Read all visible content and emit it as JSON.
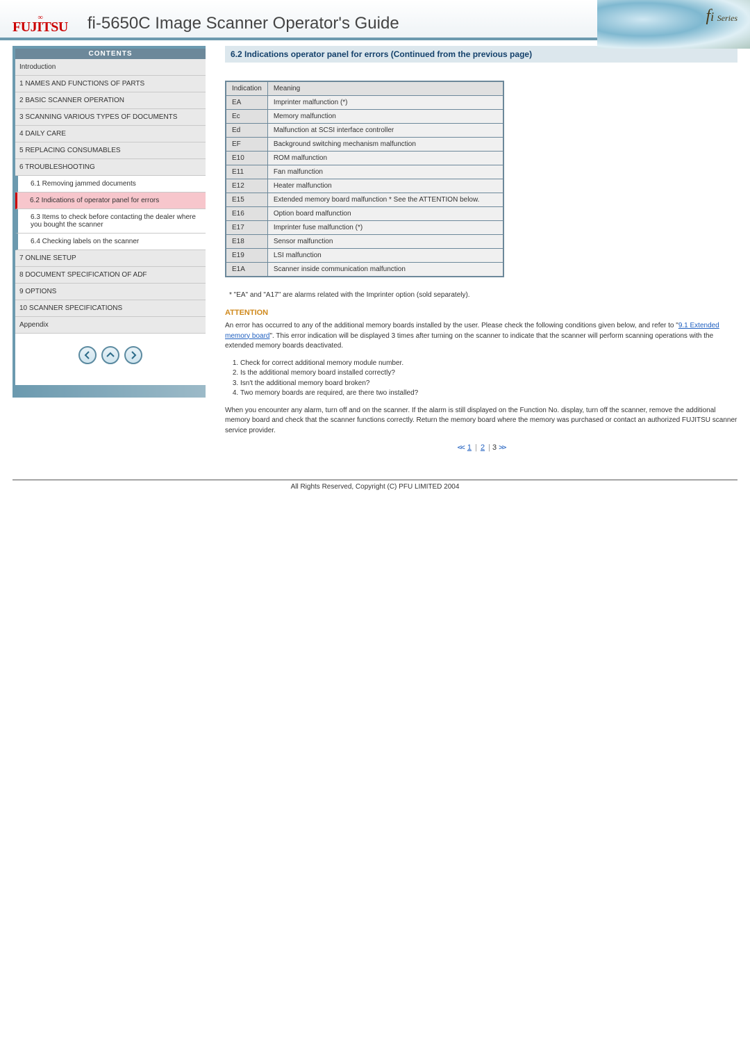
{
  "header": {
    "logo_text": "FUJITSU",
    "title": "fi-5650C Image Scanner Operator's Guide",
    "series_label": "fi Series"
  },
  "sidebar": {
    "contents_label": "CONTENTS",
    "items": [
      {
        "label": "Introduction",
        "type": "item"
      },
      {
        "label": "1 NAMES AND FUNCTIONS OF PARTS",
        "type": "item"
      },
      {
        "label": "2 BASIC SCANNER OPERATION",
        "type": "item"
      },
      {
        "label": "3 SCANNING VARIOUS TYPES OF DOCUMENTS",
        "type": "item"
      },
      {
        "label": "4 DAILY CARE",
        "type": "item"
      },
      {
        "label": "5 REPLACING CONSUMABLES",
        "type": "item"
      },
      {
        "label": "6 TROUBLESHOOTING",
        "type": "item"
      },
      {
        "label": "6.1 Removing jammed documents",
        "type": "sub"
      },
      {
        "label": "6.2 Indications of operator panel for errors",
        "type": "sub",
        "current": true
      },
      {
        "label": "6.3 Items to check before contacting the dealer where you bought the scanner",
        "type": "sub"
      },
      {
        "label": "6.4 Checking labels on the scanner",
        "type": "sub"
      },
      {
        "label": "7 ONLINE SETUP",
        "type": "item"
      },
      {
        "label": "8 DOCUMENT SPECIFICATION OF ADF",
        "type": "item"
      },
      {
        "label": "9 OPTIONS",
        "type": "item"
      },
      {
        "label": "10 SCANNER SPECIFICATIONS",
        "type": "item"
      },
      {
        "label": "Appendix",
        "type": "item"
      }
    ]
  },
  "main": {
    "section_title": "6.2 Indications operator panel for errors (Continued from the previous page)",
    "table": {
      "header": {
        "col1": "Indication",
        "col2": "Meaning"
      },
      "rows": [
        {
          "code": "EA",
          "meaning": "Imprinter malfunction (*)"
        },
        {
          "code": "Ec",
          "meaning": "Memory malfunction"
        },
        {
          "code": "Ed",
          "meaning": "Malfunction at SCSI interface controller"
        },
        {
          "code": "EF",
          "meaning": "Background switching mechanism malfunction"
        },
        {
          "code": "E10",
          "meaning": "ROM malfunction"
        },
        {
          "code": "E11",
          "meaning": "Fan malfunction"
        },
        {
          "code": "E12",
          "meaning": "Heater malfunction"
        },
        {
          "code": "E15",
          "meaning": "Extended memory board malfunction * See the ATTENTION below."
        },
        {
          "code": "E16",
          "meaning": "Option board malfunction"
        },
        {
          "code": "E17",
          "meaning": "Imprinter fuse malfunction (*)"
        },
        {
          "code": "E18",
          "meaning": "Sensor malfunction"
        },
        {
          "code": "E19",
          "meaning": "LSI malfunction"
        },
        {
          "code": "E1A",
          "meaning": "Scanner inside communication malfunction"
        }
      ]
    },
    "footnote": "* \"EA\" and \"A17\" are alarms related with the Imprinter option (sold separately).",
    "attention_label": "ATTENTION",
    "attention_para_pre": "An error has occurred to any of the additional memory boards installed by the user. Please check the following conditions given below, and refer to \"",
    "attention_link": "9.1 Extended memory board",
    "attention_para_post": "\". This error indication will be displayed 3 times after turning on the scanner to indicate that the scanner will perform scanning operations with the extended memory boards deactivated.",
    "conditions": [
      "Check for correct additional memory module number.",
      "Is the additional memory board installed correctly?",
      "Isn't the additional memory board broken?",
      "Two memory boards are required, are there two installed?"
    ],
    "closing_para": "When you encounter any alarm, turn off and on the scanner. If the alarm is still displayed on the Function No. display, turn off the scanner, remove the additional memory board and check that the scanner functions correctly. Return the memory board where the memory was purchased or contact an authorized FUJITSU scanner service provider.",
    "paginate": {
      "prev": "<<",
      "p1": "1",
      "p2": "2",
      "current": "3",
      "next": ">>"
    }
  },
  "footer": {
    "copyright": "All Rights Reserved, Copyright (C) PFU LIMITED 2004"
  }
}
